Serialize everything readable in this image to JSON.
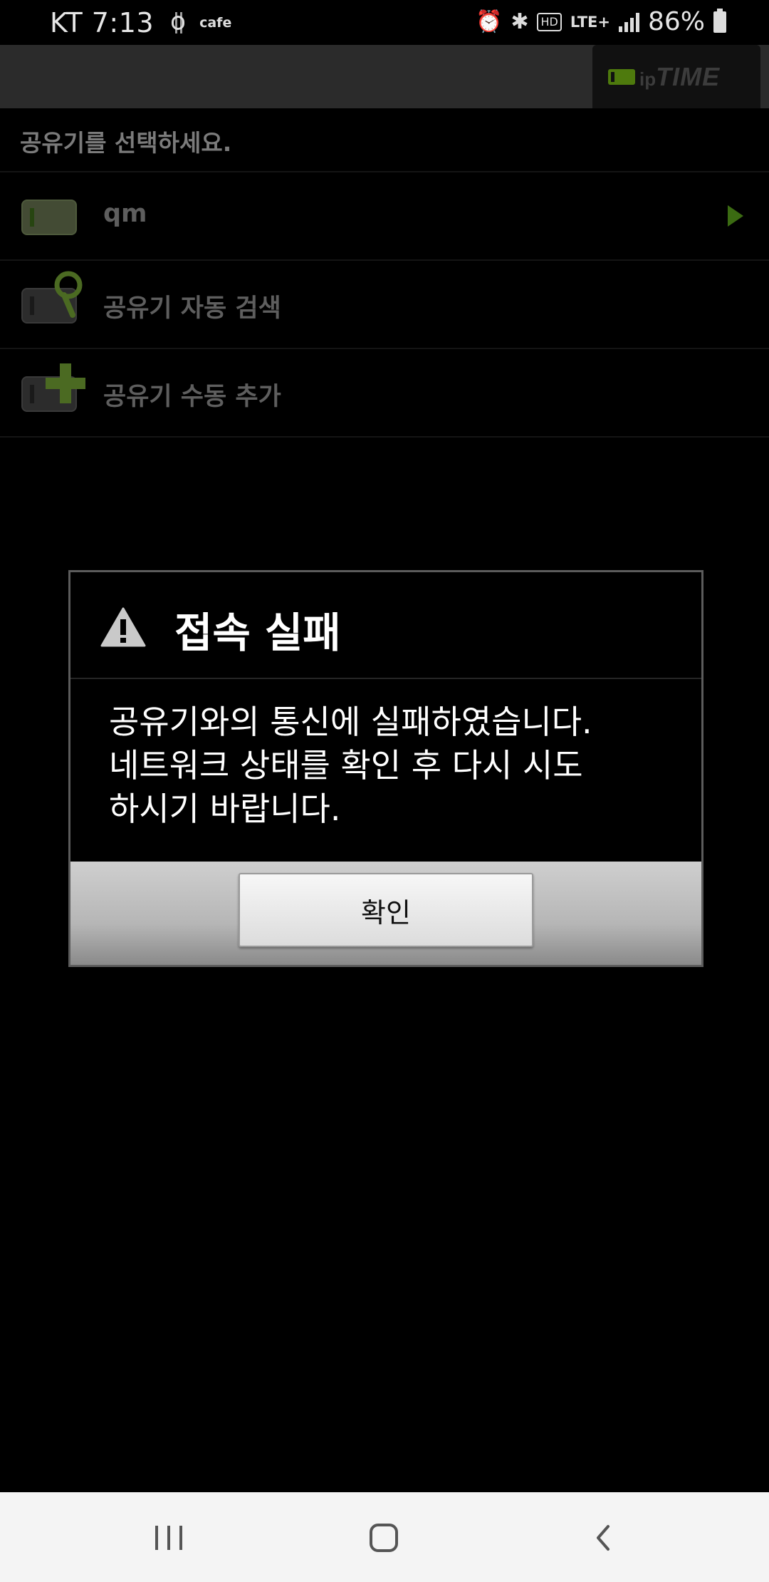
{
  "status_bar": {
    "carrier_time": "KT 7:13",
    "app_notification": "cafe",
    "hd_label": "HD",
    "network": "LTE+",
    "battery": "86%"
  },
  "app_header": {
    "logo_ip": "ip",
    "logo_time": "TIME"
  },
  "list": {
    "prompt": "공유기를 선택하세요.",
    "items": [
      {
        "label": "qm",
        "icon": "router-icon"
      },
      {
        "label": "공유기 자동 검색",
        "icon": "router-search-icon"
      },
      {
        "label": "공유기 수동 추가",
        "icon": "router-add-icon"
      }
    ]
  },
  "dialog": {
    "title": "접속 실패",
    "message_lines": [
      "공유기와의 통신에 실패하였습니다.",
      "네트워크 상태를 확인 후 다시 시도",
      "하시기 바랍니다."
    ],
    "confirm_label": "확인",
    "icon": "warning-icon"
  },
  "nav_bar": {
    "icons": [
      "recent-apps-icon",
      "home-icon",
      "back-icon"
    ]
  },
  "colors": {
    "accent_green": "#3b6b12",
    "header_bg": "#2b2b2b",
    "background": "#000000"
  }
}
